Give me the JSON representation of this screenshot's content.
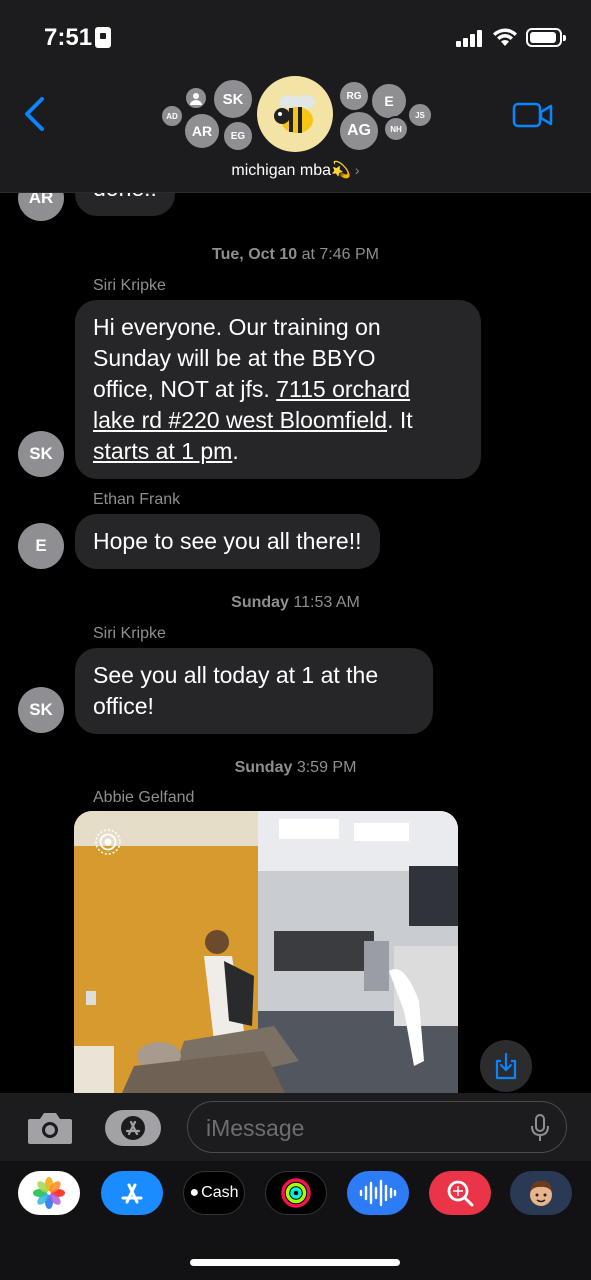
{
  "status_bar": {
    "time": "7:51"
  },
  "header": {
    "group_name": "michigan mba💫",
    "participants": [
      "AD",
      "SK",
      "AR",
      "EG",
      "RG",
      "E",
      "JS",
      "AG",
      "NH"
    ]
  },
  "messages": {
    "partial_top": {
      "avatar": "AR",
      "text": "done!!"
    },
    "stamp_1": {
      "day": "Tue, Oct 10",
      "time": "at 7:46 PM"
    },
    "msg_1": {
      "sender": "Siri Kripke",
      "avatar": "SK",
      "text_1": "Hi everyone. Our training on",
      "text_2": "Sunday will be at the BBYO",
      "text_3": "office, NOT at jfs. ",
      "link_1": "7115 orchard",
      "link_2": "lake rd #220 west Bloomfield",
      "text_4": ". It",
      "link_3": "starts at 1 pm",
      "text_5": "."
    },
    "msg_2": {
      "sender": "Ethan Frank",
      "avatar": "E",
      "text": "Hope to see you all there!!"
    },
    "stamp_2": {
      "day": "Sunday",
      "time": "11:53 AM"
    },
    "msg_3": {
      "sender": "Siri Kripke",
      "avatar": "SK",
      "text_1": "See you all today at 1 at the",
      "text_2": "office!"
    },
    "stamp_3": {
      "day": "Sunday",
      "time": "3:59 PM"
    },
    "msg_4": {
      "sender": "Abbie Gelfand"
    }
  },
  "input": {
    "placeholder": "iMessage"
  },
  "apps": [
    "photos-icon",
    "app-store-icon",
    "cash-icon",
    "fitness-icon",
    "audio-icon",
    "search-images-icon",
    "memoji-icon"
  ],
  "apps_labels": {
    "cash": "Cash"
  },
  "colors": {
    "accent": "#0a84ff",
    "bubble": "#262629",
    "header": "#1c1c1e"
  }
}
